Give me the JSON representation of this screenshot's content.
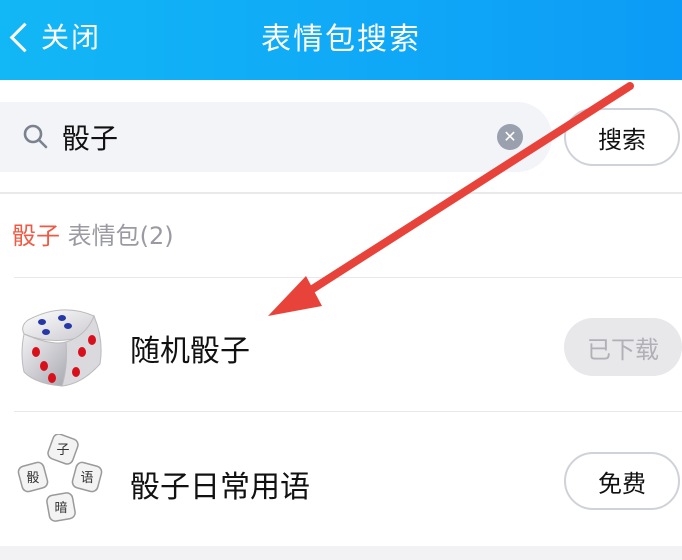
{
  "header": {
    "back_label": "关闭",
    "title": "表情包搜索"
  },
  "search": {
    "value": "骰子",
    "button_label": "搜索"
  },
  "results": {
    "keyword": "骰子",
    "tail": " 表情包(2)",
    "items": [
      {
        "name": "随机骰子",
        "action": "已下载",
        "state": "downloaded",
        "icon": "dice-icon"
      },
      {
        "name": "骰子日常用语",
        "action": "免费",
        "state": "free",
        "icon": "text-dice-icon"
      }
    ]
  },
  "colors": {
    "header": "#12b7f5",
    "keyword": "#f05a44",
    "annotation_arrow": "#e8433a"
  }
}
